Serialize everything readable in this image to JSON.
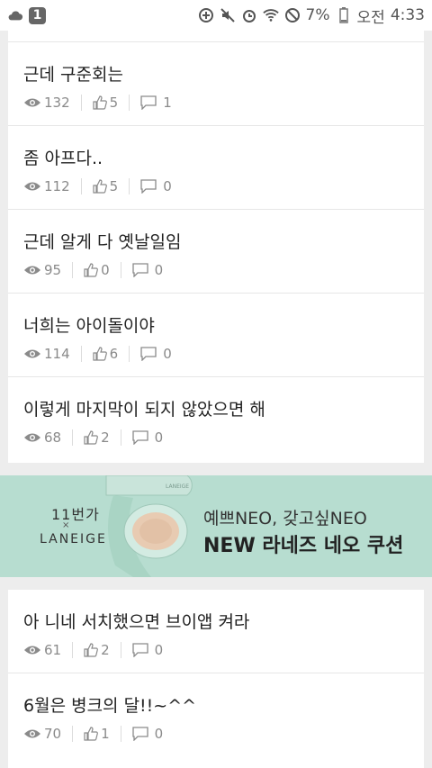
{
  "status_bar": {
    "notification_count": "1",
    "battery": "7%",
    "ampm": "오전",
    "time": "4:33"
  },
  "posts_top": [
    {
      "title": "근데 구준회는",
      "views": "132",
      "likes": "5",
      "comments": "1"
    },
    {
      "title": "좀 아프다..",
      "views": "112",
      "likes": "5",
      "comments": "0"
    },
    {
      "title": "근데 알게 다 옛날일임",
      "views": "95",
      "likes": "0",
      "comments": "0"
    },
    {
      "title": "너희는 아이돌이야",
      "views": "114",
      "likes": "6",
      "comments": "0"
    },
    {
      "title": "이렇게 마지막이 되지 않았으면 해",
      "views": "68",
      "likes": "2",
      "comments": "0"
    }
  ],
  "ad": {
    "partner_logo": "11번가",
    "x_mark": "×",
    "brand": "LANEIGE",
    "product_brand": "LANEIGE",
    "line1": "예쁘NEO, 갖고싶NEO",
    "line2": "NEW 라네즈 네오 쿠션"
  },
  "posts_bottom": [
    {
      "title": "아 니네 서치했으면 브이앱 켜라",
      "views": "61",
      "likes": "2",
      "comments": "0"
    },
    {
      "title": "6월은 병크의 달!!~^^",
      "views": "70",
      "likes": "1",
      "comments": "0"
    }
  ],
  "colors": {
    "background": "#ededed",
    "card": "#ffffff",
    "ad_background": "#b7ddd0",
    "meta_text": "#8a8a8a"
  }
}
